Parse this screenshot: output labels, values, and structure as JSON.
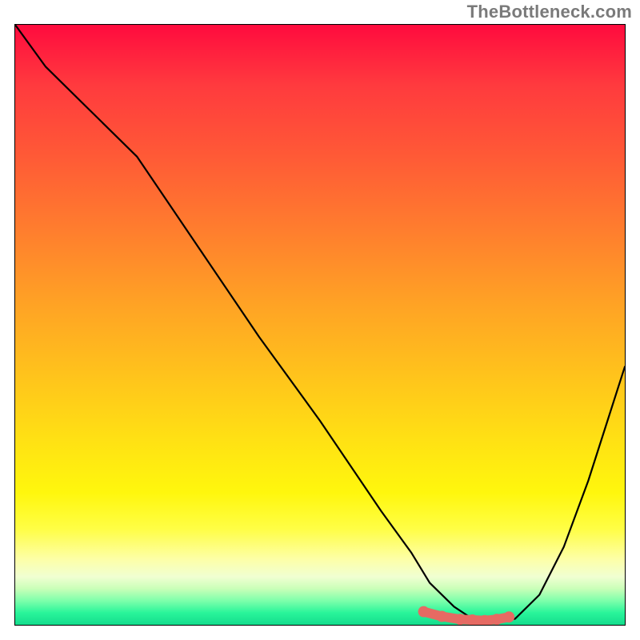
{
  "watermark": {
    "text": "TheBottleneck.com"
  },
  "colors": {
    "curve_stroke": "#000000",
    "marker_fill": "#e66a63",
    "frame": "#000000"
  },
  "chart_data": {
    "type": "line",
    "title": "",
    "xlabel": "",
    "ylabel": "",
    "xlim": [
      0,
      100
    ],
    "ylim": [
      0,
      100
    ],
    "grid": false,
    "legend": false,
    "description": "Bottleneck-style curve: steep descent from top-left, reaching near-zero around x≈75, then rising toward the right edge; minimum band highlighted with salmon markers.",
    "series": [
      {
        "name": "bottleneck_curve",
        "x": [
          0,
          5,
          12,
          20,
          30,
          40,
          50,
          60,
          65,
          68,
          72,
          75,
          78,
          82,
          86,
          90,
          94,
          100
        ],
        "values": [
          100,
          93,
          86,
          78,
          63,
          48,
          34,
          19,
          12,
          7,
          3,
          1,
          0.5,
          1,
          5,
          13,
          24,
          43
        ]
      }
    ],
    "markers": {
      "name": "optimal_band",
      "x": [
        67,
        70,
        73,
        75,
        77,
        79,
        81
      ],
      "values": [
        2.2,
        1.4,
        0.9,
        0.8,
        0.7,
        0.9,
        1.3
      ]
    }
  }
}
